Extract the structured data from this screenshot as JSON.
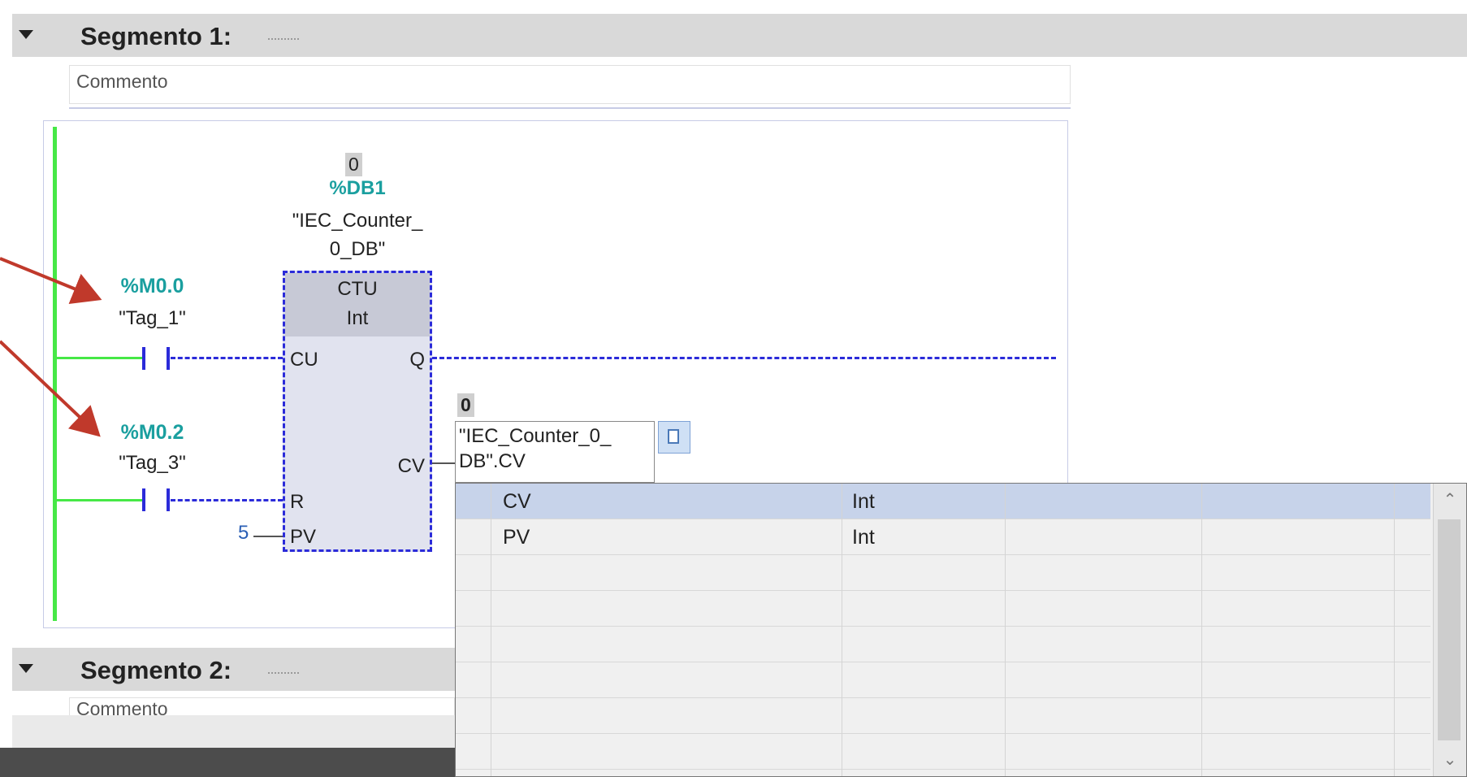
{
  "segment1": {
    "title": "Segmento 1:",
    "comment_placeholder": "Commento"
  },
  "segment2": {
    "title": "Segmento 2:",
    "comment_placeholder": "Commento"
  },
  "contact1": {
    "address": "%M0.0",
    "tag": "\"Tag_1\""
  },
  "contact2": {
    "address": "%M0.2",
    "tag": "\"Tag_3\""
  },
  "counter": {
    "instance_value": "0",
    "db_address": "%DB1",
    "db_name_line1": "\"IEC_Counter_",
    "db_name_line2": "0_DB\"",
    "type": "CTU",
    "datatype": "Int",
    "pins": {
      "cu": "CU",
      "r": "R",
      "pv": "PV",
      "q": "Q",
      "cv": "CV"
    },
    "pv_value": "5"
  },
  "cv_output": {
    "value": "0",
    "edit_text_line1": "\"IEC_Counter_0_",
    "edit_text_line2": "DB\".CV"
  },
  "dropdown": {
    "rows": [
      {
        "name": "CV",
        "type": "Int",
        "selected": true
      },
      {
        "name": "PV",
        "type": "Int",
        "selected": false
      }
    ],
    "scroll_up_icon": "chevron-up-icon",
    "scroll_down_icon": "chevron-down-icon"
  },
  "colors": {
    "power_rail": "#46e846",
    "wire": "#2b2bd9",
    "address": "#1a9f9f",
    "annotation_arrow": "#c0392b",
    "selected_row": "#c7d3ea"
  }
}
